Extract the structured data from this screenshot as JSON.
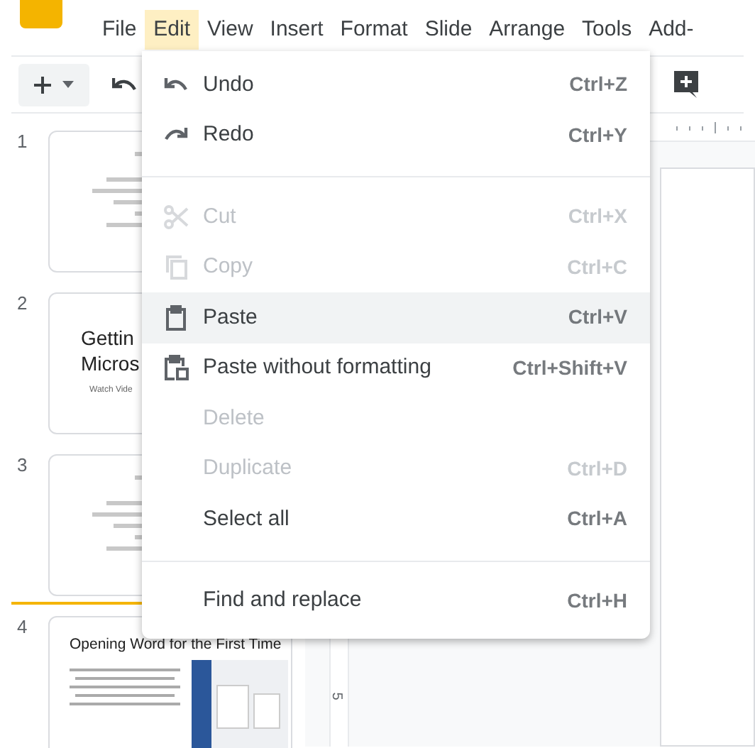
{
  "menu_bar": [
    {
      "label": "File",
      "selected": false
    },
    {
      "label": "Edit",
      "selected": true
    },
    {
      "label": "View",
      "selected": false
    },
    {
      "label": "Insert",
      "selected": false
    },
    {
      "label": "Format",
      "selected": false
    },
    {
      "label": "Slide",
      "selected": false
    },
    {
      "label": "Arrange",
      "selected": false
    },
    {
      "label": "Tools",
      "selected": false
    },
    {
      "label": "Add-",
      "selected": false
    }
  ],
  "slides": [
    {
      "number": "1",
      "kind": "lines"
    },
    {
      "number": "2",
      "kind": "title",
      "title": [
        "Gettin",
        "Micros"
      ],
      "subtitle": "Watch Vide"
    },
    {
      "number": "3",
      "kind": "lines"
    },
    {
      "number": "4",
      "kind": "screenshot",
      "title": "Opening Word for the First Time"
    }
  ],
  "ruler_label": "5",
  "edit_menu": [
    {
      "kind": "item",
      "label": "Undo",
      "shortcut": "Ctrl+Z",
      "disabled": false,
      "selected": false
    },
    {
      "kind": "item",
      "label": "Redo",
      "shortcut": "Ctrl+Y",
      "disabled": false,
      "selected": false
    },
    {
      "kind": "separator"
    },
    {
      "kind": "item",
      "label": "Cut",
      "shortcut": "Ctrl+X",
      "disabled": true,
      "selected": false
    },
    {
      "kind": "item",
      "label": "Copy",
      "shortcut": "Ctrl+C",
      "disabled": true,
      "selected": false
    },
    {
      "kind": "item",
      "label": "Paste",
      "shortcut": "Ctrl+V",
      "disabled": false,
      "selected": true
    },
    {
      "kind": "item",
      "label": "Paste without formatting",
      "shortcut": "Ctrl+Shift+V",
      "disabled": false,
      "selected": false
    },
    {
      "kind": "item",
      "label": "Delete",
      "disabled": true,
      "selected": false
    },
    {
      "kind": "item",
      "label": "Duplicate",
      "shortcut": "Ctrl+D",
      "disabled": true,
      "selected": false
    },
    {
      "kind": "item",
      "label": "Select all",
      "shortcut": "Ctrl+A",
      "disabled": false,
      "selected": false
    },
    {
      "kind": "separator"
    },
    {
      "kind": "item",
      "label": "Find and replace",
      "shortcut": "Ctrl+H",
      "disabled": false,
      "selected": false
    }
  ]
}
